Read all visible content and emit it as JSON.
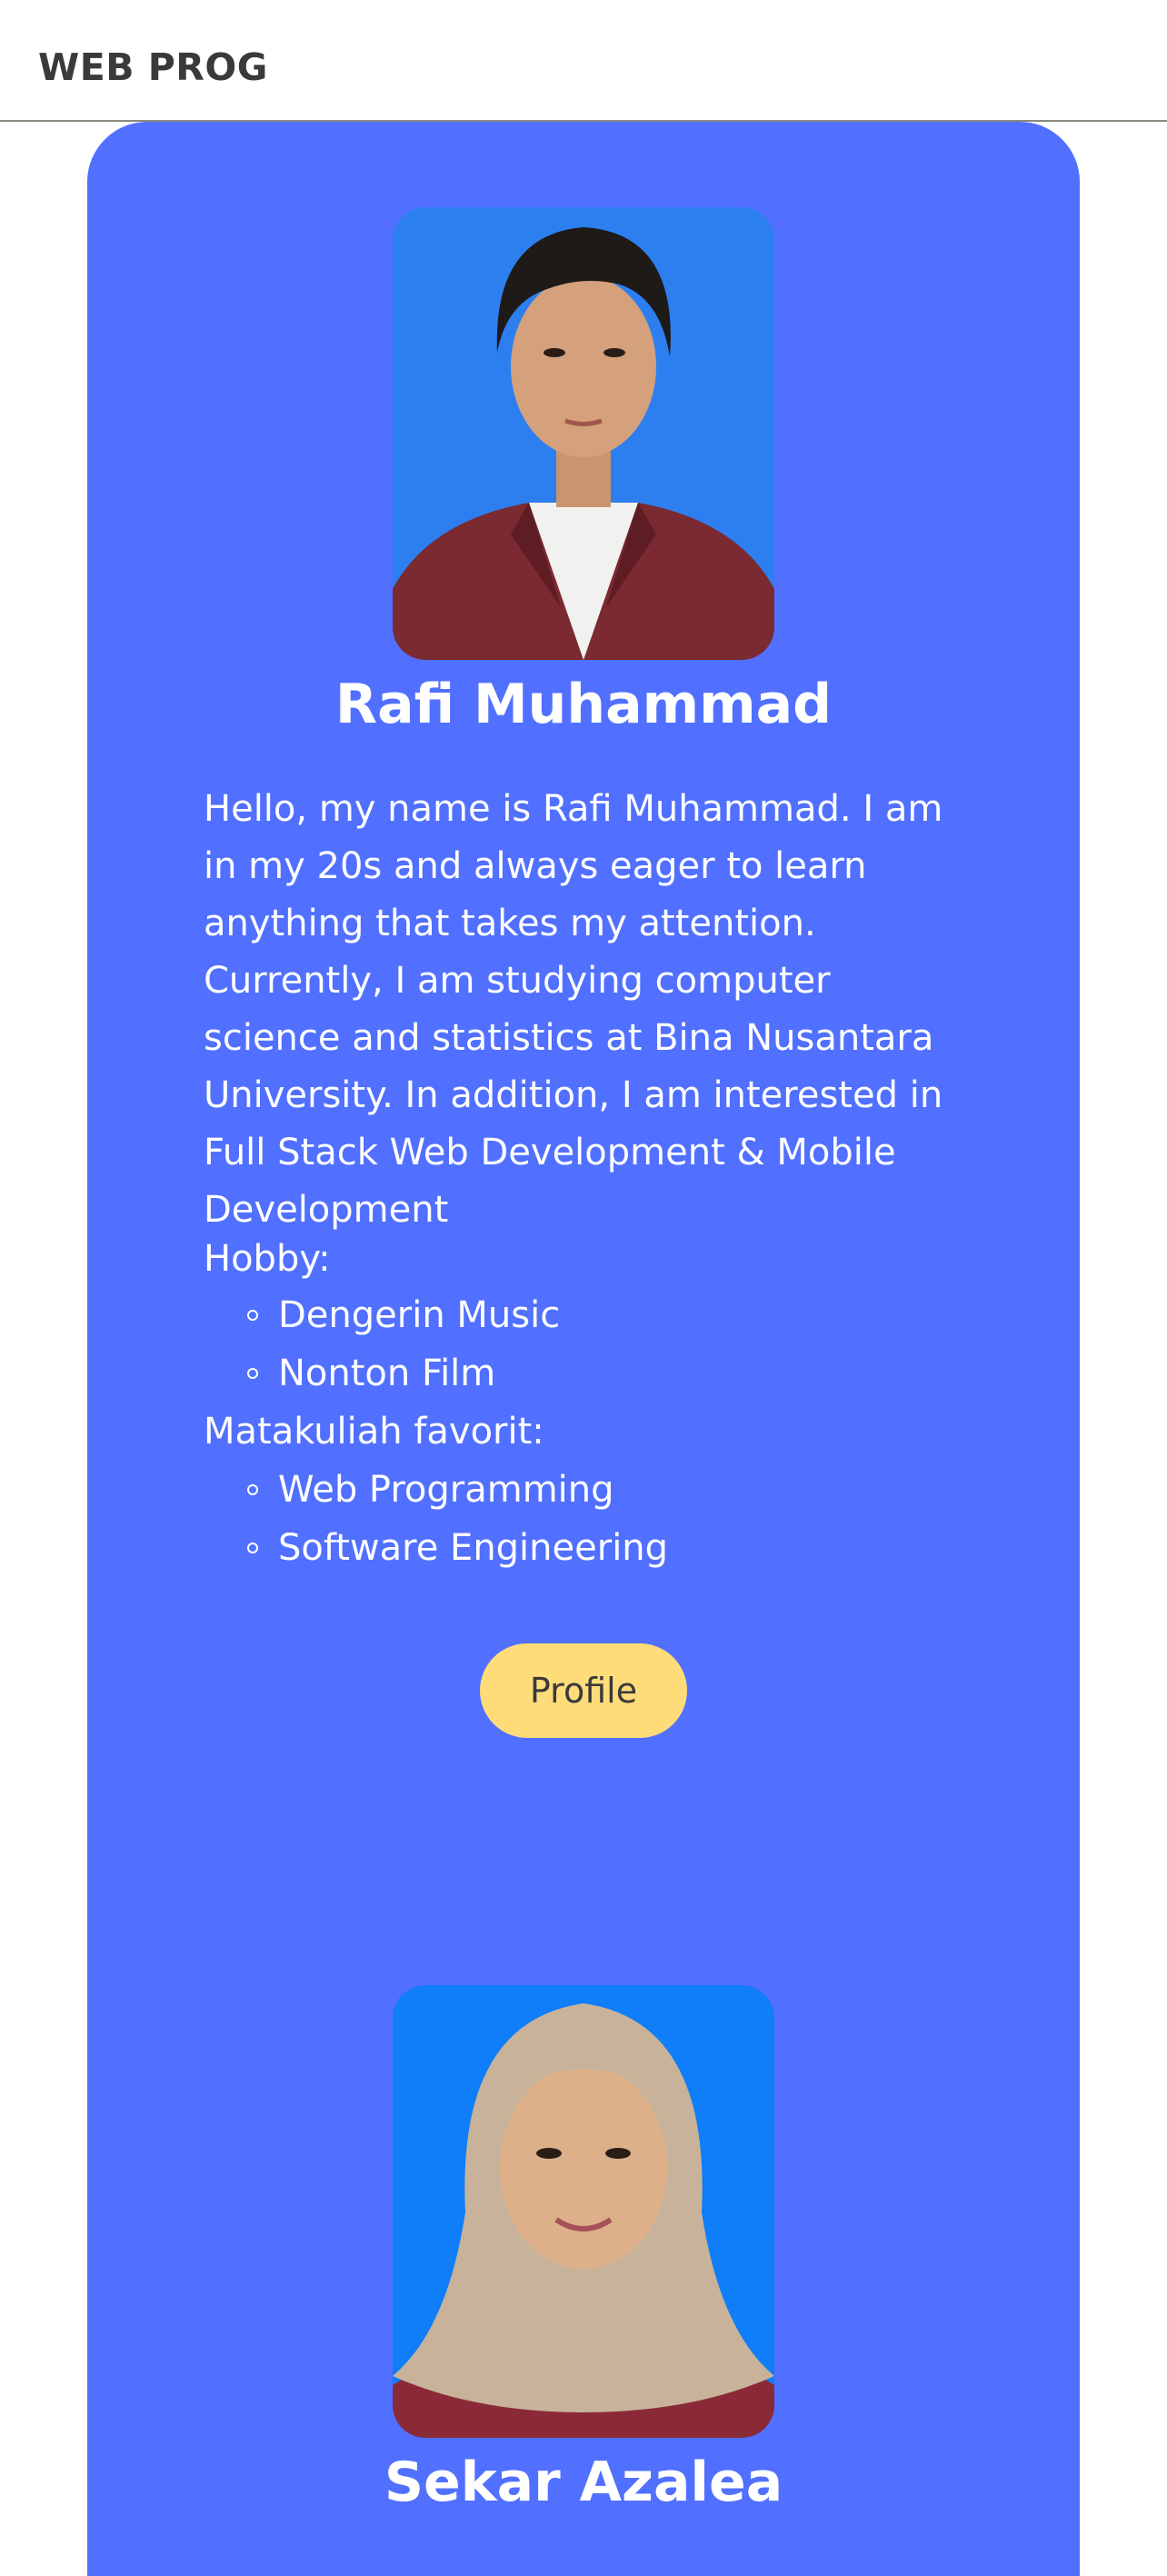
{
  "navbar": {
    "brand": "WEB PROG"
  },
  "profiles": [
    {
      "name": "Rafi Muhammad",
      "bio": "Hello, my name is Rafi Muhammad. I am in my 20s and always eager to learn anything that takes my attention. Currently, I am studying computer science and statistics at Bina Nusantara University. In addition, I am interested in Full Stack Web Development & Mobile Development",
      "hobby_label": "Hobby:",
      "hobbies": [
        "Dengerin Music",
        "Nonton Film"
      ],
      "courses_label": "Matakuliah favorit:",
      "courses": [
        "Web Programming",
        "Software Engineering"
      ],
      "button_label": "Profile"
    },
    {
      "name": "Sekar Azalea"
    }
  ],
  "colors": {
    "card_bg": "#5170ff",
    "button_bg": "#ffdc7a",
    "photo1_bg": "#2d7ff0",
    "photo2_bg": "#0f7ef8"
  }
}
